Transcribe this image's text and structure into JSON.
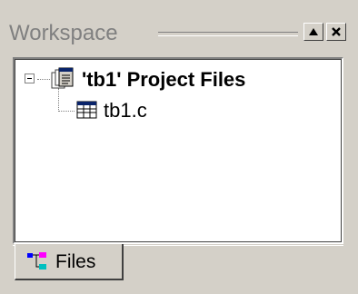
{
  "workspace": {
    "title": "Workspace",
    "buttons": [
      {
        "icon": "restore-icon"
      },
      {
        "icon": "close-icon"
      }
    ]
  },
  "tree": {
    "project": {
      "label": "'tb1' Project Files",
      "icon": "project-files-icon",
      "expanded": true
    },
    "files": [
      {
        "label": "tb1.c",
        "icon": "source-file-icon"
      }
    ]
  },
  "tabs": [
    {
      "label": "Files",
      "icon": "files-tab-icon",
      "active": true
    }
  ]
}
